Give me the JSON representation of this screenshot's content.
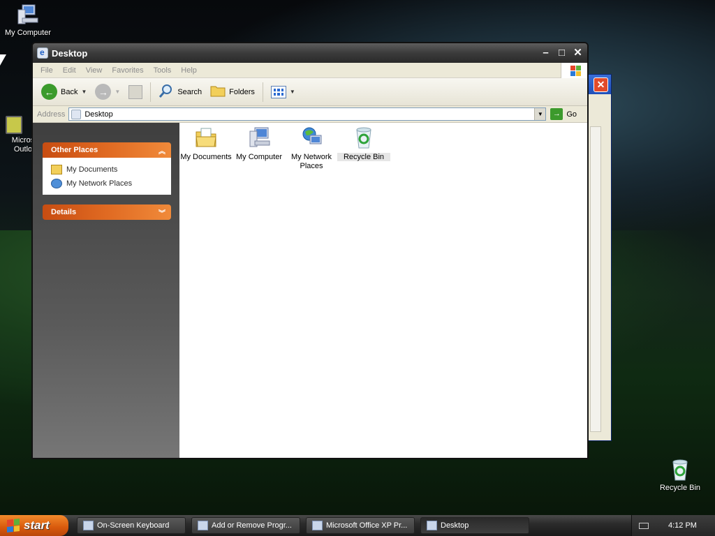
{
  "desktop": {
    "icons": [
      {
        "label": "My Computer"
      },
      {
        "label": "Micros Outlo"
      },
      {
        "label": "Recycle Bin"
      }
    ]
  },
  "window": {
    "title": "Desktop",
    "menu": [
      "File",
      "Edit",
      "View",
      "Favorites",
      "Tools",
      "Help"
    ],
    "toolbar": {
      "back_label": "Back",
      "search_label": "Search",
      "folders_label": "Folders"
    },
    "address": {
      "label": "Address",
      "value": "Desktop",
      "go_label": "Go"
    },
    "taskpane": {
      "other_places": {
        "header": "Other Places",
        "items": [
          "My Documents",
          "My Network Places"
        ]
      },
      "details": {
        "header": "Details"
      }
    },
    "items": [
      {
        "label": "My Documents"
      },
      {
        "label": "My Computer"
      },
      {
        "label": "My Network Places"
      },
      {
        "label": "Recycle Bin"
      }
    ]
  },
  "taskbar": {
    "start_label": "start",
    "tasks": [
      {
        "label": "On-Screen Keyboard"
      },
      {
        "label": "Add or Remove Progr..."
      },
      {
        "label": "Microsoft Office XP Pr..."
      },
      {
        "label": "Desktop"
      }
    ],
    "clock": "4:12 PM"
  },
  "colors": {
    "panel_header": "#e06a22",
    "start_button": "#d8590c"
  }
}
